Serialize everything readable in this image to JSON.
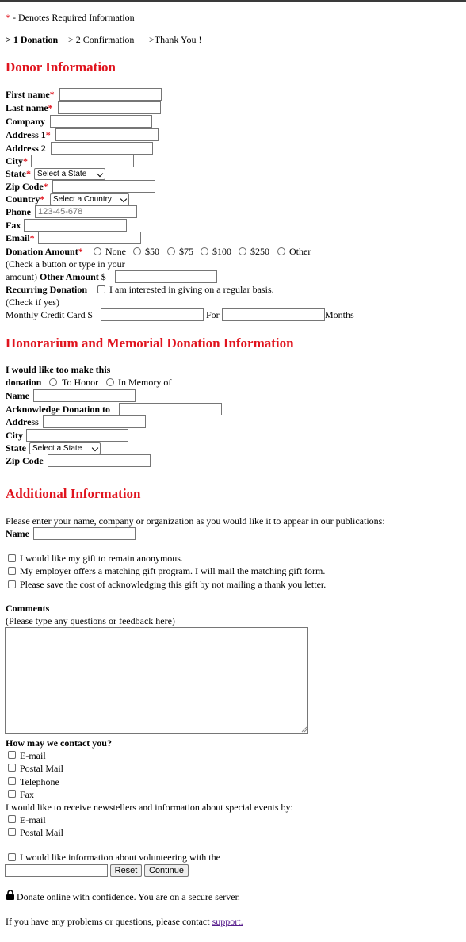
{
  "required_note": {
    "star": "*",
    "text": "- Denotes Required Information"
  },
  "steps": [
    "> 1 Donation",
    "> 2 Confirmation",
    ">Thank You !"
  ],
  "sections": {
    "donor": "Donor Information",
    "honorarium": "Honorarium and Memorial Donation Information",
    "additional": "Additional Information"
  },
  "donor": {
    "first_name": "First name",
    "last_name": "Last name",
    "company": "Company",
    "address1": "Address 1",
    "address2": "Address 2",
    "city": "City",
    "state": "State",
    "state_select": "Select a State",
    "zip": "Zip Code",
    "country": "Country",
    "country_select": "Select a Country",
    "phone": "Phone",
    "phone_placeholder": "123-45-678",
    "fax": "Fax",
    "email": "Email",
    "star": "*",
    "donation_amount": "Donation Amount",
    "amount_options": [
      "None",
      "$50",
      "$75",
      "$100",
      "$250",
      "Other"
    ],
    "check_note_1": "(Check a button or type in your",
    "check_note_2": "amount)",
    "other_amount": "Other Amount",
    "dollar": "$",
    "recurring": "Recurring Donation",
    "recurring_option": "I am interested in giving on a regular basis.",
    "check_if_yes": "(Check if yes)",
    "monthly": "Monthly Credit Card $",
    "for": "For",
    "months": "Months"
  },
  "honor": {
    "intro_1": "I would like too make this",
    "intro_2": "donation",
    "to_honor": "To Honor",
    "in_memory": "In Memory of",
    "name": "Name",
    "acknowledge": "Acknowledge Donation to",
    "address": "Address",
    "city": "City",
    "state": "State",
    "state_select": "Select a State",
    "zip": "Zip Code"
  },
  "additional": {
    "publication_note": "Please enter your name, company or organization as you would like it to appear in our publications:",
    "name": "Name",
    "options": [
      "I would like my gift to remain anonymous.",
      "My employer offers a matching gift program. I will mail the matching gift form.",
      "Please save the cost of acknowledging this gift by not mailing a thank you letter."
    ],
    "comments": "Comments",
    "comments_hint": "(Please type any questions or feedback here)",
    "contact_q": "How may we contact you?",
    "contact_options": [
      "E-mail",
      "Postal Mail",
      "Telephone",
      "Fax"
    ],
    "newsletter_q": "I would like to receive newstellers and information about special events by:",
    "newsletter_options": [
      "E-mail",
      "Postal Mail"
    ],
    "volunteer": "I would like information about volunteering with the"
  },
  "buttons": {
    "reset": "Reset",
    "continue": "Continue"
  },
  "footer": {
    "secure": "Donate online with confidence. You are on a secure server.",
    "problems": "If you have any problems or questions, please contact",
    "support": "support."
  }
}
